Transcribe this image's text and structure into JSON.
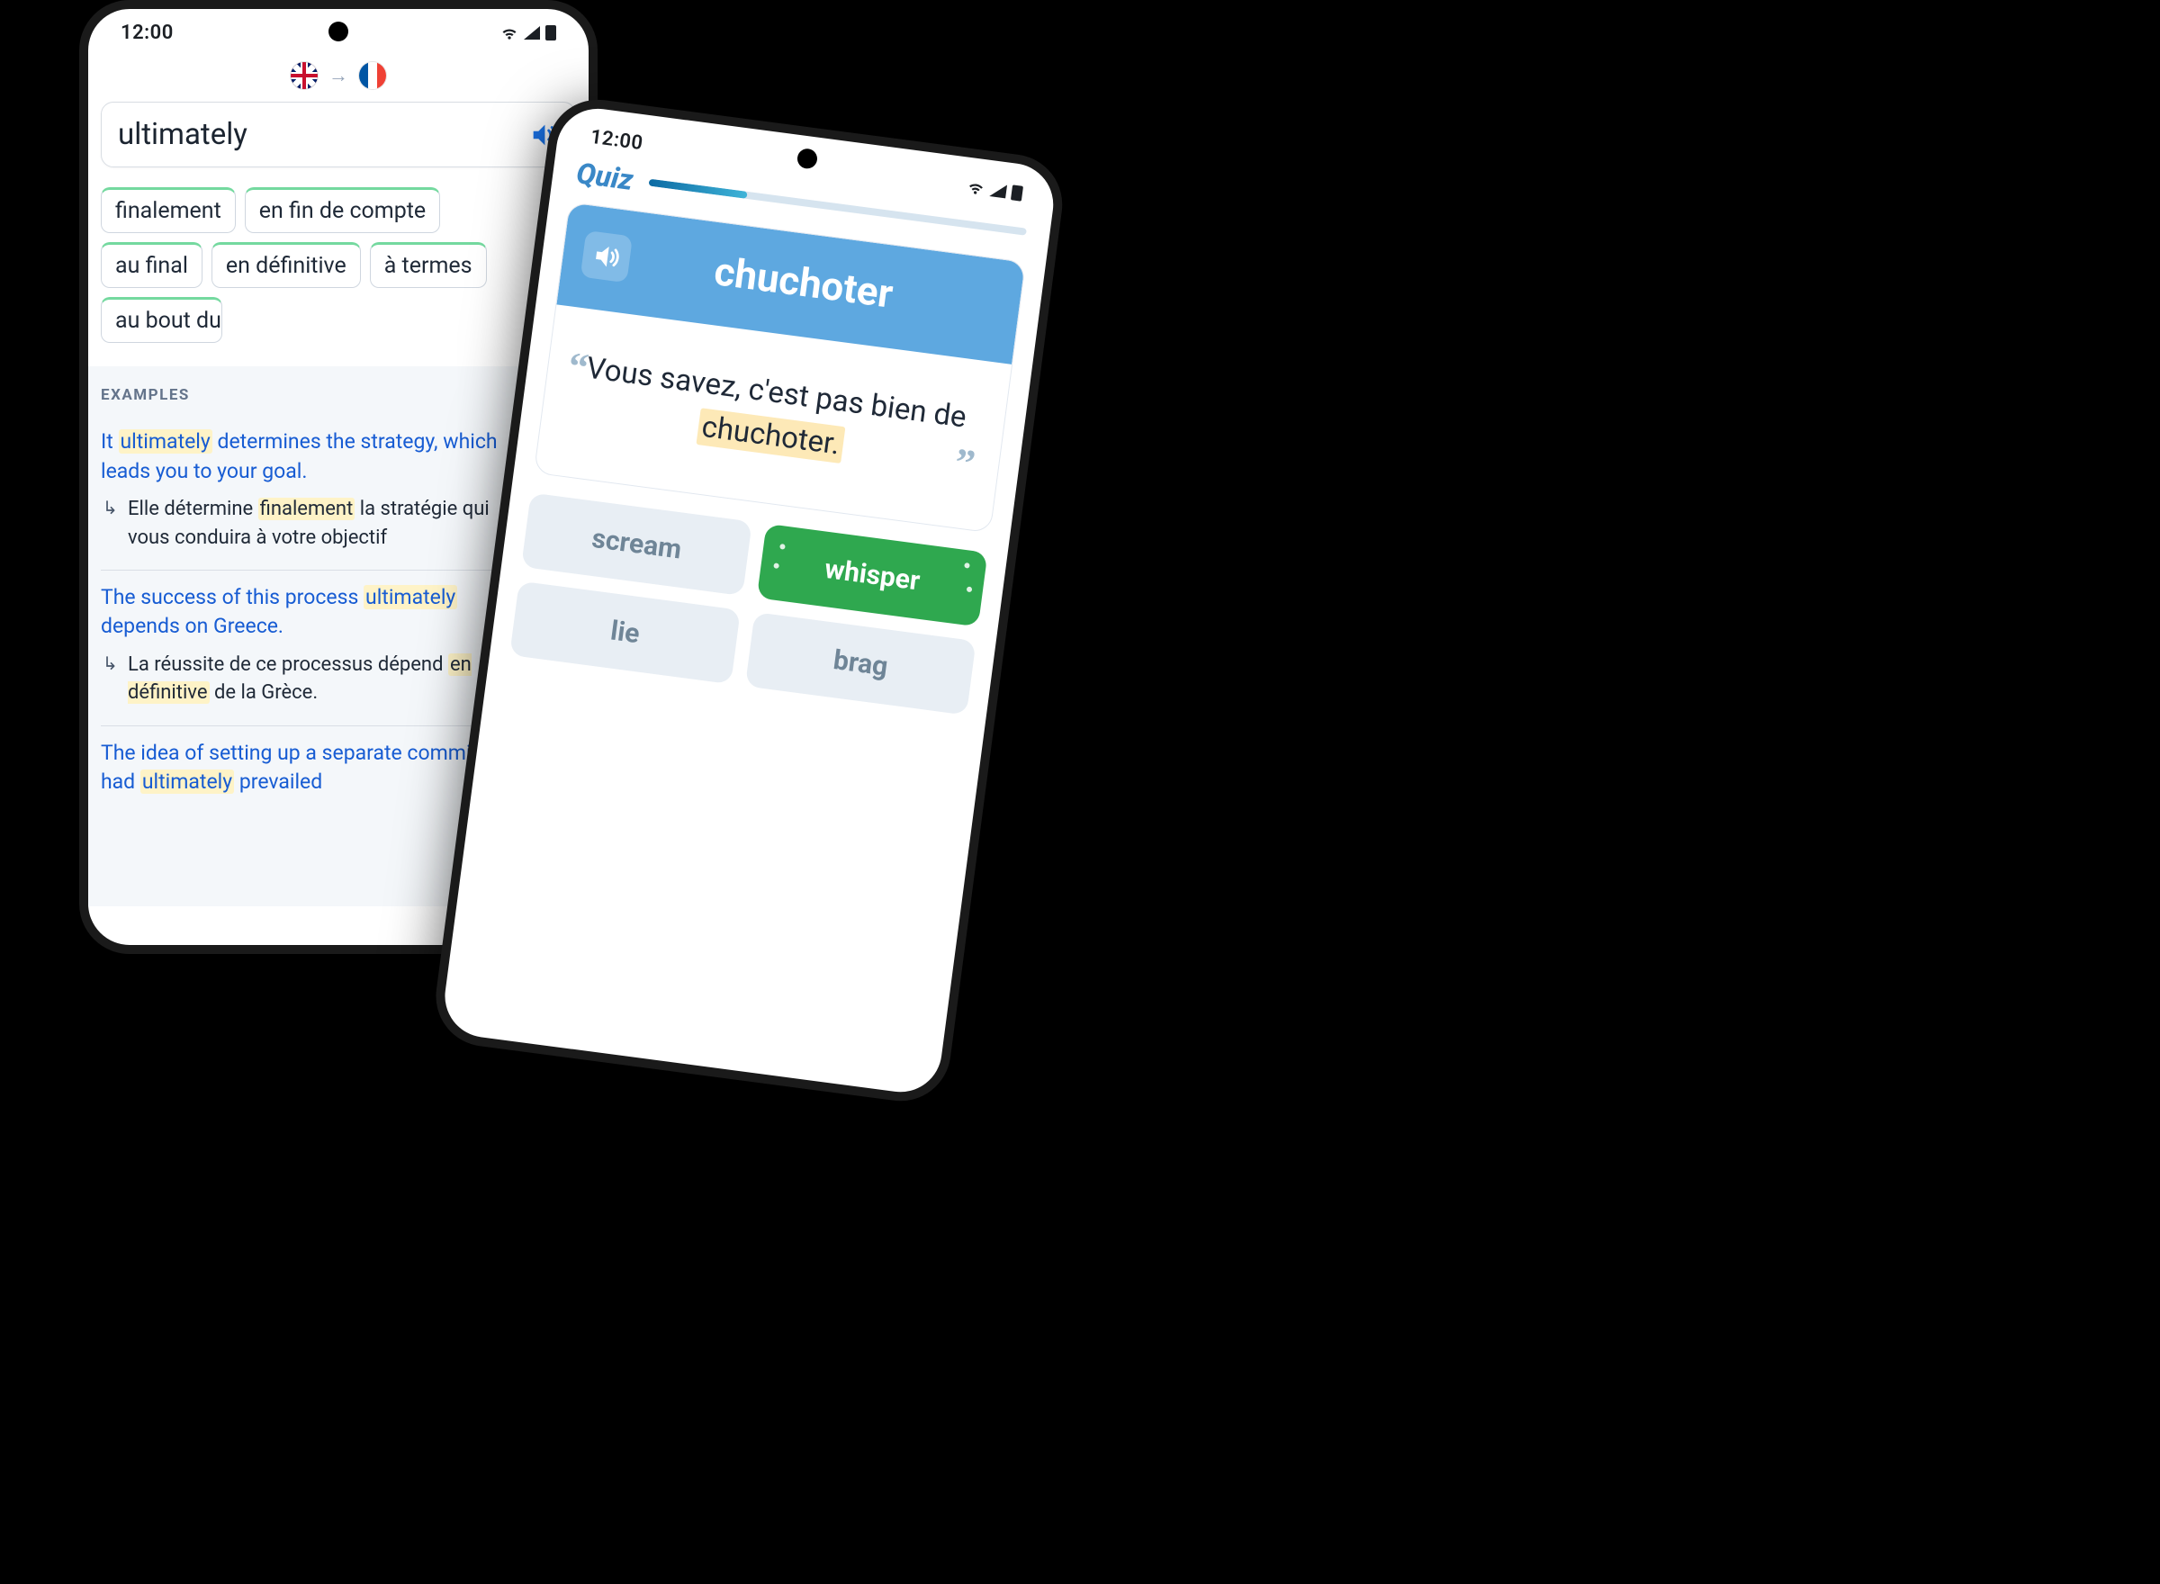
{
  "status": {
    "time": "12:00"
  },
  "phone1": {
    "lang_from": "en-GB",
    "lang_to": "fr-FR",
    "search_word": "ultimately",
    "translations": [
      "finalement",
      "en fin de compte",
      "au final",
      "en définitive",
      "à termes",
      "au bout du"
    ],
    "examples_heading": "EXAMPLES",
    "examples": [
      {
        "source_pre": "It ",
        "source_hl": "ultimately",
        "source_post": " determines the strategy, which leads you to your goal.",
        "target_pre": "Elle détermine ",
        "target_hl": "finalement",
        "target_post": " la stratégie qui vous conduira à votre objectif",
        "starred": true
      },
      {
        "source_pre": "The success of this process ",
        "source_hl": "ultimately",
        "source_post": " depends on Greece.",
        "target_pre": "La réussite de ce processus dépend ",
        "target_hl": "en définitive",
        "target_post": " de la Grèce.",
        "starred": false
      },
      {
        "source_pre": "The idea of setting up a separate committee had ",
        "source_hl": "ultimately",
        "source_post": " prevailed",
        "target_pre": "",
        "target_hl": "",
        "target_post": "",
        "starred": false
      }
    ]
  },
  "phone2": {
    "title": "Quiz",
    "progress_pct": 26,
    "prompt_word": "chuchoter",
    "sentence_pre": "Vous savez, c'est pas bien de ",
    "sentence_hl": "chuchoter.",
    "answers": [
      {
        "label": "scream",
        "correct": false
      },
      {
        "label": "whisper",
        "correct": true
      },
      {
        "label": "lie",
        "correct": false
      },
      {
        "label": "brag",
        "correct": false
      }
    ]
  }
}
